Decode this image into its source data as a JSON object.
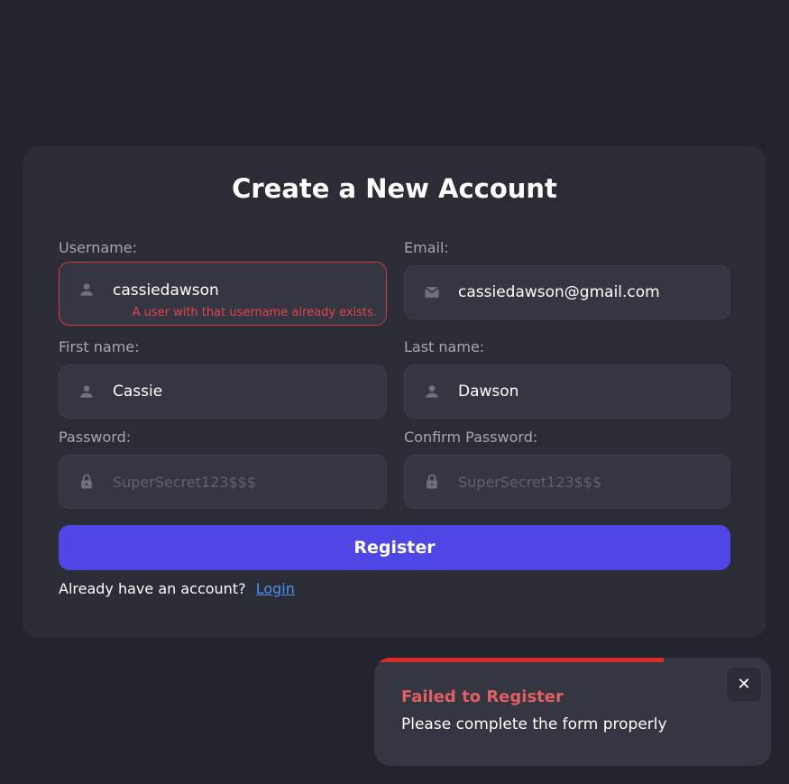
{
  "form": {
    "title": "Create a New Account",
    "username": {
      "label": "Username:",
      "value": "cassiedawson",
      "error": "A user with that username already exists.",
      "icon": "user-icon"
    },
    "email": {
      "label": "Email:",
      "value": "cassiedawson@gmail.com",
      "icon": "mail-icon"
    },
    "first_name": {
      "label": "First name:",
      "value": "Cassie",
      "icon": "user-icon"
    },
    "last_name": {
      "label": "Last name:",
      "value": "Dawson",
      "icon": "user-icon"
    },
    "password": {
      "label": "Password:",
      "placeholder": "SuperSecret123$$$",
      "icon": "lock-icon"
    },
    "confirm_password": {
      "label": "Confirm Password:",
      "placeholder": "SuperSecret123$$$",
      "icon": "lock-icon"
    },
    "register_label": "Register",
    "footer_text": "Already have an account?",
    "login_label": "Login"
  },
  "toast": {
    "title": "Failed to Register",
    "message": "Please complete the form properly",
    "close_glyph": "✕",
    "progress": 0.73,
    "progress_color": "#dc2b2b"
  },
  "colors": {
    "background": "#22252d",
    "card": "#2a2d36",
    "input": "#343741",
    "accent": "#4f46e5",
    "error": "#e0444c",
    "link": "#4d8ff0"
  }
}
